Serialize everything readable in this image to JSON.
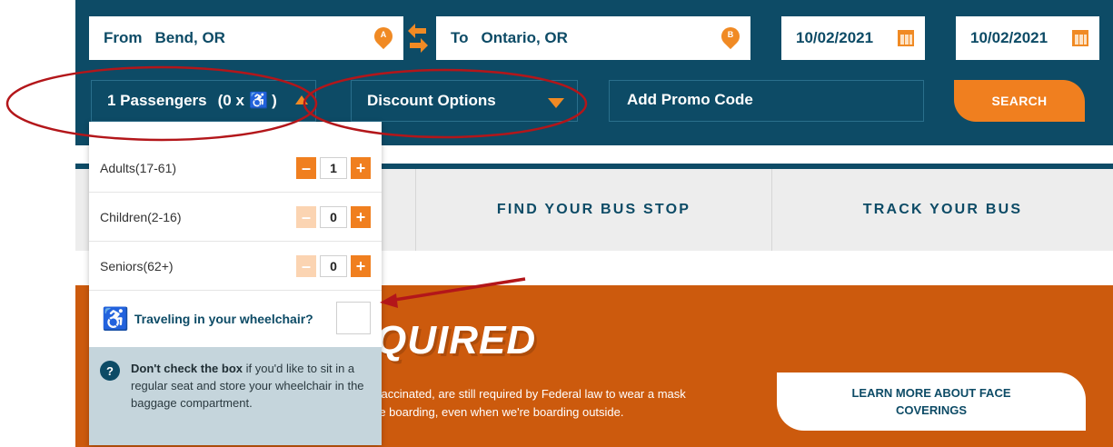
{
  "booking": {
    "from_label": "From",
    "from_value": "Bend, OR",
    "from_pin": "A",
    "to_label": "To",
    "to_value": "Ontario, OR",
    "to_pin": "B",
    "depart_date": "10/02/2021",
    "return_date": "10/02/2021",
    "swap_icon": "swap-arrows-icon",
    "calendar_icon": "calendar-icon",
    "passengers_label": "1 Passengers",
    "passengers_paren_open": "(0 x",
    "passengers_paren_close": ")",
    "wheelchair_glyph": "♿",
    "discount_label": "Discount Options",
    "promo_label": "Add Promo Code",
    "search_label": "SEARCH"
  },
  "nav": {
    "tabs": [
      {
        "label": ""
      },
      {
        "label": "FIND YOUR BUS STOP"
      },
      {
        "label": "TRACK YOUR BUS"
      }
    ]
  },
  "banner": {
    "heading": "QUIRED",
    "text_line1": "vaccinated, are still required by Federal law to wear a mask",
    "text_line2": "re boarding, even when we're boarding outside.",
    "learn_more": "LEARN MORE ABOUT FACE COVERINGS"
  },
  "passenger_panel": {
    "rows": [
      {
        "label": "Adults(17-61)",
        "count": "1",
        "minus_enabled": true
      },
      {
        "label": "Children(2-16)",
        "count": "0",
        "minus_enabled": false
      },
      {
        "label": "Seniors(62+)",
        "count": "0",
        "minus_enabled": false
      }
    ],
    "minus_glyph": "–",
    "plus_glyph": "+",
    "wheelchair_glyph": "♿",
    "wheelchair_question": "Traveling in your wheelchair?",
    "help_glyph": "?",
    "info_bold": "Don't check the box",
    "info_rest": " if you'd like to sit in a regular seat and store your wheelchair in the baggage compartment."
  },
  "colors": {
    "brand_navy": "#0d4b66",
    "accent_orange": "#f07f1f",
    "banner_orange": "#cc5a0d",
    "annotation_red": "#b3161a"
  }
}
